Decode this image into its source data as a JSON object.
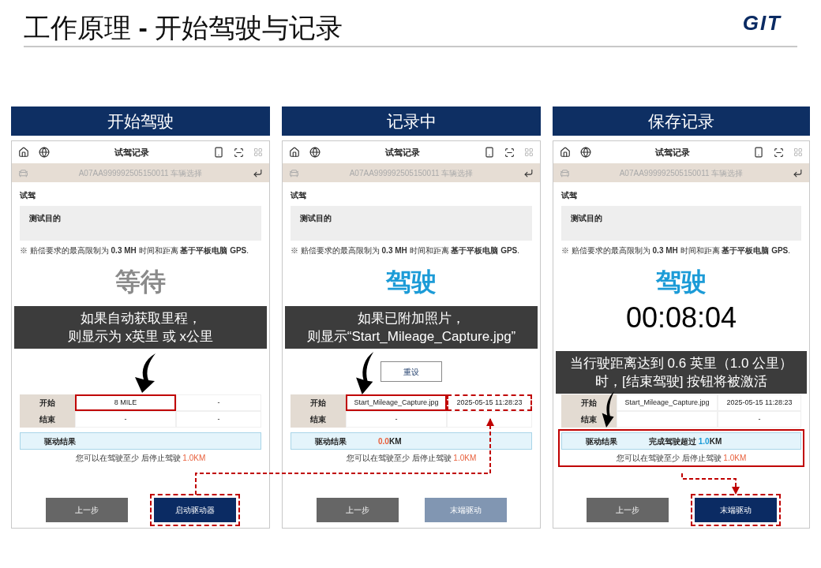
{
  "title": "工作原理 **-** 开始驾驶与记录",
  "logo": "GIT",
  "panels": [
    {
      "heading": "开始驾驶",
      "caption": [
        "如果自动获取里程，",
        "则显示为 x英里 或 x公里"
      ],
      "screen": {
        "title": "试驾记录",
        "vehicle": "A07AA999992505150011 车辆选择",
        "section": "试驾",
        "purpose": "测试目的",
        "note": "※ 赔偿要求的最高限制为 **0.3 MH** 时间和距离 **基于平板电脑 GPS**.",
        "status": {
          "text": "等待",
          "active": false
        },
        "rows": [
          {
            "label": "开始",
            "cells": [
              {
                "text": "8 MILE",
                "boxed": true,
                "dashed_box": false
              },
              {
                "text": "-",
                "boxed": false,
                "dashed_box": false
              }
            ]
          },
          {
            "label": "结束",
            "cells": [
              {
                "text": "-",
                "boxed": false,
                "dashed_box": false
              },
              {
                "text": "-",
                "boxed": false,
                "dashed_box": false
              }
            ]
          }
        ],
        "result": {
          "label": "驱动结果",
          "boxed": false
        },
        "hint": "您可以在驾驶至少 后停止驾驶",
        "hint_distance": "1.0KM",
        "buttons": [
          {
            "label": "上一步",
            "kind": "back",
            "dashed_box": false
          },
          {
            "label": "启动驱动器",
            "kind": "next",
            "enabled": true,
            "dashed_box": true
          }
        ]
      }
    },
    {
      "heading": "记录中",
      "caption": [
        "如果已附加照片，",
        "则显示“Start_Mileage_Capture.jpg”"
      ],
      "screen": {
        "title": "试驾记录",
        "vehicle": "A07AA999992505150011 车辆选择",
        "section": "试驾",
        "purpose": "测试目的",
        "note": "※ 赔偿要求的最高限制为 **0.3 MH** 时间和距离 **基于平板电脑 GPS**.",
        "status": {
          "text": "驾驶",
          "active": true
        },
        "reset": "重设",
        "rows": [
          {
            "label": "开始",
            "cells": [
              {
                "text": "Start_Mileage_Capture.jpg",
                "boxed": true,
                "dashed_box": false
              },
              {
                "text": "2025-05-15 11:28:23",
                "boxed": false,
                "dashed_box": true
              }
            ]
          },
          {
            "label": "结束",
            "cells": [
              {
                "text": "-",
                "boxed": false,
                "dashed_box": false
              },
              {
                "text": "",
                "boxed": false,
                "dashed_box": false
              }
            ]
          }
        ],
        "result": {
          "label": "驱动结果",
          "number": "0.0",
          "unit": "KM",
          "reached": false,
          "boxed": false
        },
        "hint": "您可以在驾驶至少 后停止驾驶",
        "hint_distance": "1.0KM",
        "buttons": [
          {
            "label": "上一步",
            "kind": "back",
            "dashed_box": false
          },
          {
            "label": "末端驱动",
            "kind": "next",
            "enabled": false,
            "dashed_box": false
          }
        ]
      }
    },
    {
      "heading": "保存记录",
      "caption": [
        "当行驶距离达到 0.6 英里（1.0 公里）",
        "时，[结束驾驶] 按钮将被激活"
      ],
      "screen": {
        "title": "试驾记录",
        "vehicle": "A07AA999992505150011 车辆选择",
        "section": "试驾",
        "purpose": "测试目的",
        "note": "※ 赔偿要求的最高限制为 **0.3 MH** 时间和距离 **基于平板电脑 GPS**.",
        "status": {
          "text": "驾驶",
          "active": true
        },
        "timer": "00:08:04",
        "rows": [
          {
            "label": "开始",
            "cells": [
              {
                "text": "Start_Mileage_Capture.jpg",
                "boxed": false,
                "dashed_box": false
              },
              {
                "text": "2025-05-15 11:28:23",
                "boxed": false,
                "dashed_box": false
              }
            ]
          },
          {
            "label": "结束",
            "cells": [
              {
                "text": "",
                "boxed": false,
                "dashed_box": false
              },
              {
                "text": "-",
                "boxed": false,
                "dashed_box": false
              }
            ]
          }
        ],
        "result": {
          "label": "驱动结果",
          "text": "完成驾驶超过 ",
          "number": "1.0",
          "unit": "KM",
          "reached": true,
          "boxed": true
        },
        "hint": "您可以在驾驶至少 后停止驾驶",
        "hint_distance": "1.0KM",
        "buttons": [
          {
            "label": "上一步",
            "kind": "back",
            "dashed_box": false
          },
          {
            "label": "末端驱动",
            "kind": "next",
            "enabled": true,
            "dashed_box": true
          }
        ]
      }
    }
  ]
}
